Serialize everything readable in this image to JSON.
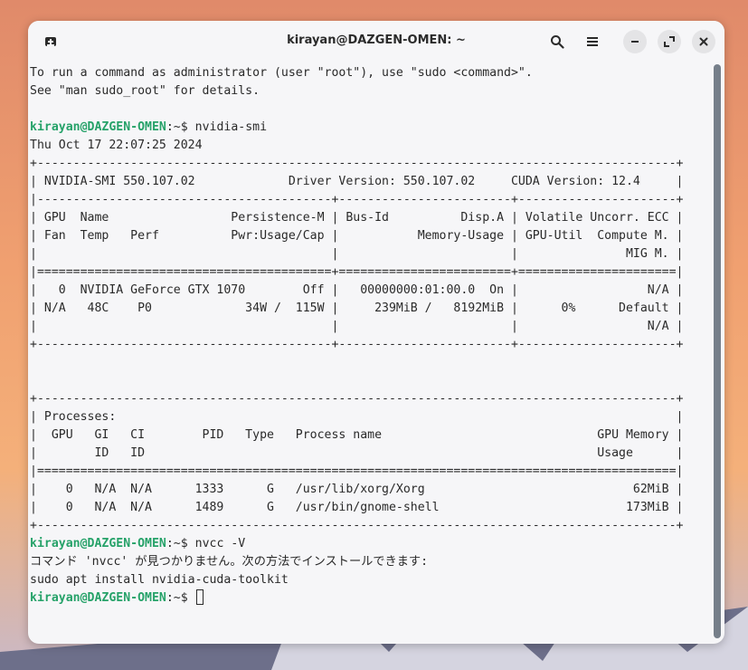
{
  "window": {
    "title": "kirayan@DAZGEN-OMEN: ~"
  },
  "icons": {
    "new_tab": "new-tab-icon",
    "search": "search-icon",
    "menu": "hamburger-menu-icon",
    "minimize": "minimize-icon",
    "maximize": "maximize-icon",
    "close": "close-icon"
  },
  "colors": {
    "prompt_user": "#26a269",
    "window_bg": "#f6f6f8",
    "scrollbar": "#767f8a"
  },
  "terminal": {
    "prompt_user": "kirayan@DAZGEN-OMEN",
    "prompt_suffix": ":~$ ",
    "lines": [
      {
        "kind": "text",
        "text": "To run a command as administrator (user \"root\"), use \"sudo <command>\"."
      },
      {
        "kind": "text",
        "text": "See \"man sudo_root\" for details."
      },
      {
        "kind": "text",
        "text": ""
      },
      {
        "kind": "prompt",
        "text": "nvidia-smi"
      },
      {
        "kind": "text",
        "text": "Thu Oct 17 22:07:25 2024"
      },
      {
        "kind": "text",
        "text": "+-----------------------------------------------------------------------------------------+"
      },
      {
        "kind": "text",
        "text": "| NVIDIA-SMI 550.107.02             Driver Version: 550.107.02     CUDA Version: 12.4     |"
      },
      {
        "kind": "text",
        "text": "|-----------------------------------------+------------------------+----------------------+"
      },
      {
        "kind": "text",
        "text": "| GPU  Name                 Persistence-M | Bus-Id          Disp.A | Volatile Uncorr. ECC |"
      },
      {
        "kind": "text",
        "text": "| Fan  Temp   Perf          Pwr:Usage/Cap |           Memory-Usage | GPU-Util  Compute M. |"
      },
      {
        "kind": "text",
        "text": "|                                         |                        |               MIG M. |"
      },
      {
        "kind": "text",
        "text": "|=========================================+========================+======================|"
      },
      {
        "kind": "text",
        "text": "|   0  NVIDIA GeForce GTX 1070        Off |   00000000:01:00.0  On |                  N/A |"
      },
      {
        "kind": "text",
        "text": "| N/A   48C    P0             34W /  115W |     239MiB /   8192MiB |      0%      Default |"
      },
      {
        "kind": "text",
        "text": "|                                         |                        |                  N/A |"
      },
      {
        "kind": "text",
        "text": "+-----------------------------------------+------------------------+----------------------+"
      },
      {
        "kind": "text",
        "text": ""
      },
      {
        "kind": "text",
        "text": ""
      },
      {
        "kind": "text",
        "text": "+-----------------------------------------------------------------------------------------+"
      },
      {
        "kind": "text",
        "text": "| Processes:                                                                              |"
      },
      {
        "kind": "text",
        "text": "|  GPU   GI   CI        PID   Type   Process name                              GPU Memory |"
      },
      {
        "kind": "text",
        "text": "|        ID   ID                                                               Usage      |"
      },
      {
        "kind": "text",
        "text": "|=========================================================================================|"
      },
      {
        "kind": "text",
        "text": "|    0   N/A  N/A      1333      G   /usr/lib/xorg/Xorg                             62MiB |"
      },
      {
        "kind": "text",
        "text": "|    0   N/A  N/A      1489      G   /usr/bin/gnome-shell                          173MiB |"
      },
      {
        "kind": "text",
        "text": "+-----------------------------------------------------------------------------------------+"
      },
      {
        "kind": "prompt",
        "text": "nvcc -V"
      },
      {
        "kind": "text",
        "text": "コマンド 'nvcc' が見つかりません。次の方法でインストールできます:"
      },
      {
        "kind": "text",
        "text": "sudo apt install nvidia-cuda-toolkit"
      },
      {
        "kind": "prompt_cursor",
        "text": ""
      }
    ]
  }
}
